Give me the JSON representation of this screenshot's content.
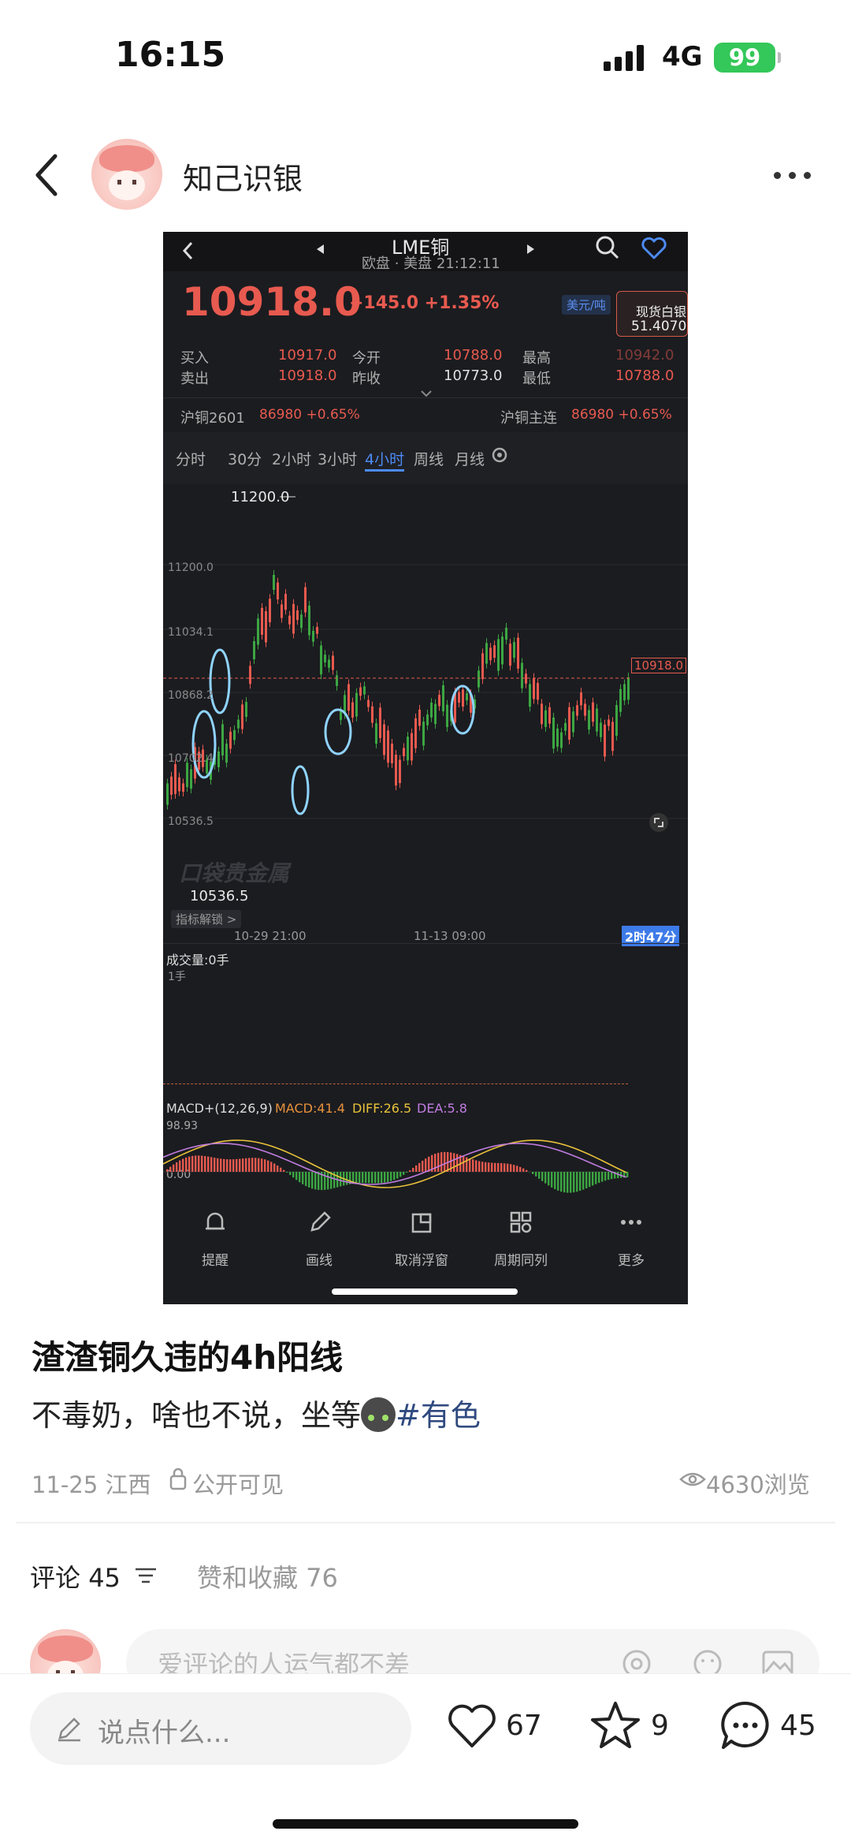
{
  "status_bar": {
    "time": "16:15",
    "network": "4G",
    "battery": "99"
  },
  "header": {
    "username": "知己识银"
  },
  "screenshot": {
    "title": "LME铜",
    "subtitle": "欧盘 · 美盘 21:12:11",
    "price": "10918.0",
    "change": "+145.0 +1.35%",
    "unit_button": "美元/吨",
    "spot_silver": {
      "label": "现货白银",
      "value": "51.4070"
    },
    "quotes": {
      "buy_label": "买入",
      "buy": "10917.0",
      "sell_label": "卖出",
      "sell": "10918.0",
      "open_label": "今开",
      "open": "10788.0",
      "prev_label": "昨收",
      "prev": "10773.0",
      "high_label": "最高",
      "high": "10942.0",
      "low_label": "最低",
      "low": "10788.0"
    },
    "related_left": {
      "name": "沪铜2601",
      "value": "86980 +0.65%"
    },
    "related_right": {
      "name": "沪铜主连",
      "value": "86980 +0.65%"
    },
    "tabs": [
      "分时",
      "30分",
      "2小时",
      "3小时",
      "4小时",
      "周线",
      "月线"
    ],
    "active_tab": "4小时",
    "y_labels": [
      "11200.0",
      "11034.1",
      "10868.2",
      "10702.4",
      "10536.5"
    ],
    "high_marker": "11200.0",
    "low_marker": "10536.5",
    "current_tag": "10918.0",
    "watermark": "口袋贵金属",
    "indicator_unlock": "指标解锁 >",
    "x_labels": [
      "10-29 21:00",
      "11-13 09:00"
    ],
    "countdown": "2时47分",
    "volume_label": "成交量:0手",
    "volume_unit": "1手",
    "macd": {
      "params": "MACD+(12,26,9)",
      "macd": "MACD:41.4",
      "diff": "DIFF:26.5",
      "dea": "DEA:5.8",
      "y_top": "98.93",
      "y_zero": "0.00"
    },
    "bottom_nav": [
      "提醒",
      "画线",
      "取消浮窗",
      "周期同列",
      "更多"
    ],
    "colors": {
      "up": "#e85a4f",
      "down": "#3ca642",
      "accent": "#4c8bf5",
      "circle": "#8fd3ff"
    }
  },
  "post": {
    "title": "渣渣铜久违的4h阳线",
    "body": "不毒奶，啥也不说，坐等",
    "hashtag": "#有色",
    "date_location": "11-25 江西",
    "visibility": "公开可见",
    "views": "4630浏览"
  },
  "comments": {
    "tab_label": "评论",
    "count": "45",
    "likes_tab": "赞和收藏 76",
    "placeholder": "爱评论的人运气都不差"
  },
  "bottom_bar": {
    "input_placeholder": "说点什么...",
    "likes": "67",
    "favorites": "9",
    "comments": "45"
  }
}
